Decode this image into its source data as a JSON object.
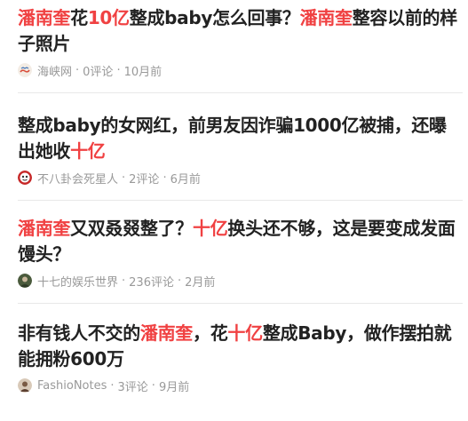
{
  "feed": {
    "items": [
      {
        "title": [
          {
            "t": "潘南奎",
            "hl": true
          },
          {
            "t": "花",
            "hl": false
          },
          {
            "t": "10亿",
            "hl": true
          },
          {
            "t": "整成baby怎么回事？",
            "hl": false
          },
          {
            "t": "潘南奎",
            "hl": true
          },
          {
            "t": "整容以前的样子照片",
            "hl": false
          }
        ],
        "source": "海峡网",
        "comments": "0评论",
        "time": "10月前",
        "avatar_icon": "haixia-logo-icon"
      },
      {
        "title": [
          {
            "t": "整成baby的女网红，前男友因诈骗1000亿被捕，还曝出她收",
            "hl": false
          },
          {
            "t": "十亿",
            "hl": true
          }
        ],
        "source": "不八卦会死星人",
        "comments": "2评论",
        "time": "6月前",
        "avatar_icon": "gossip-avatar-icon"
      },
      {
        "title": [
          {
            "t": "潘南奎",
            "hl": true
          },
          {
            "t": "又双叒叕整了？",
            "hl": false
          },
          {
            "t": "十亿",
            "hl": true
          },
          {
            "t": "换头还不够，这是要变成发面馒头？",
            "hl": false
          }
        ],
        "source": "十七的娱乐世界",
        "comments": "236评论",
        "time": "2月前",
        "avatar_icon": "entertainment-avatar-icon"
      },
      {
        "title": [
          {
            "t": "非有钱人不交的",
            "hl": false
          },
          {
            "t": "潘南奎",
            "hl": true
          },
          {
            "t": "，花",
            "hl": false
          },
          {
            "t": "十亿",
            "hl": true
          },
          {
            "t": "整成Baby，做作摆拍就能拥粉600万",
            "hl": false
          }
        ],
        "source": "FashioNotes",
        "comments": "3评论",
        "time": "9月前",
        "avatar_icon": "fashion-avatar-icon"
      }
    ],
    "meta_separator": "·",
    "colors": {
      "highlight": "#f04142",
      "title": "#222222",
      "meta": "#999999",
      "divider": "#e8e8e8"
    }
  }
}
